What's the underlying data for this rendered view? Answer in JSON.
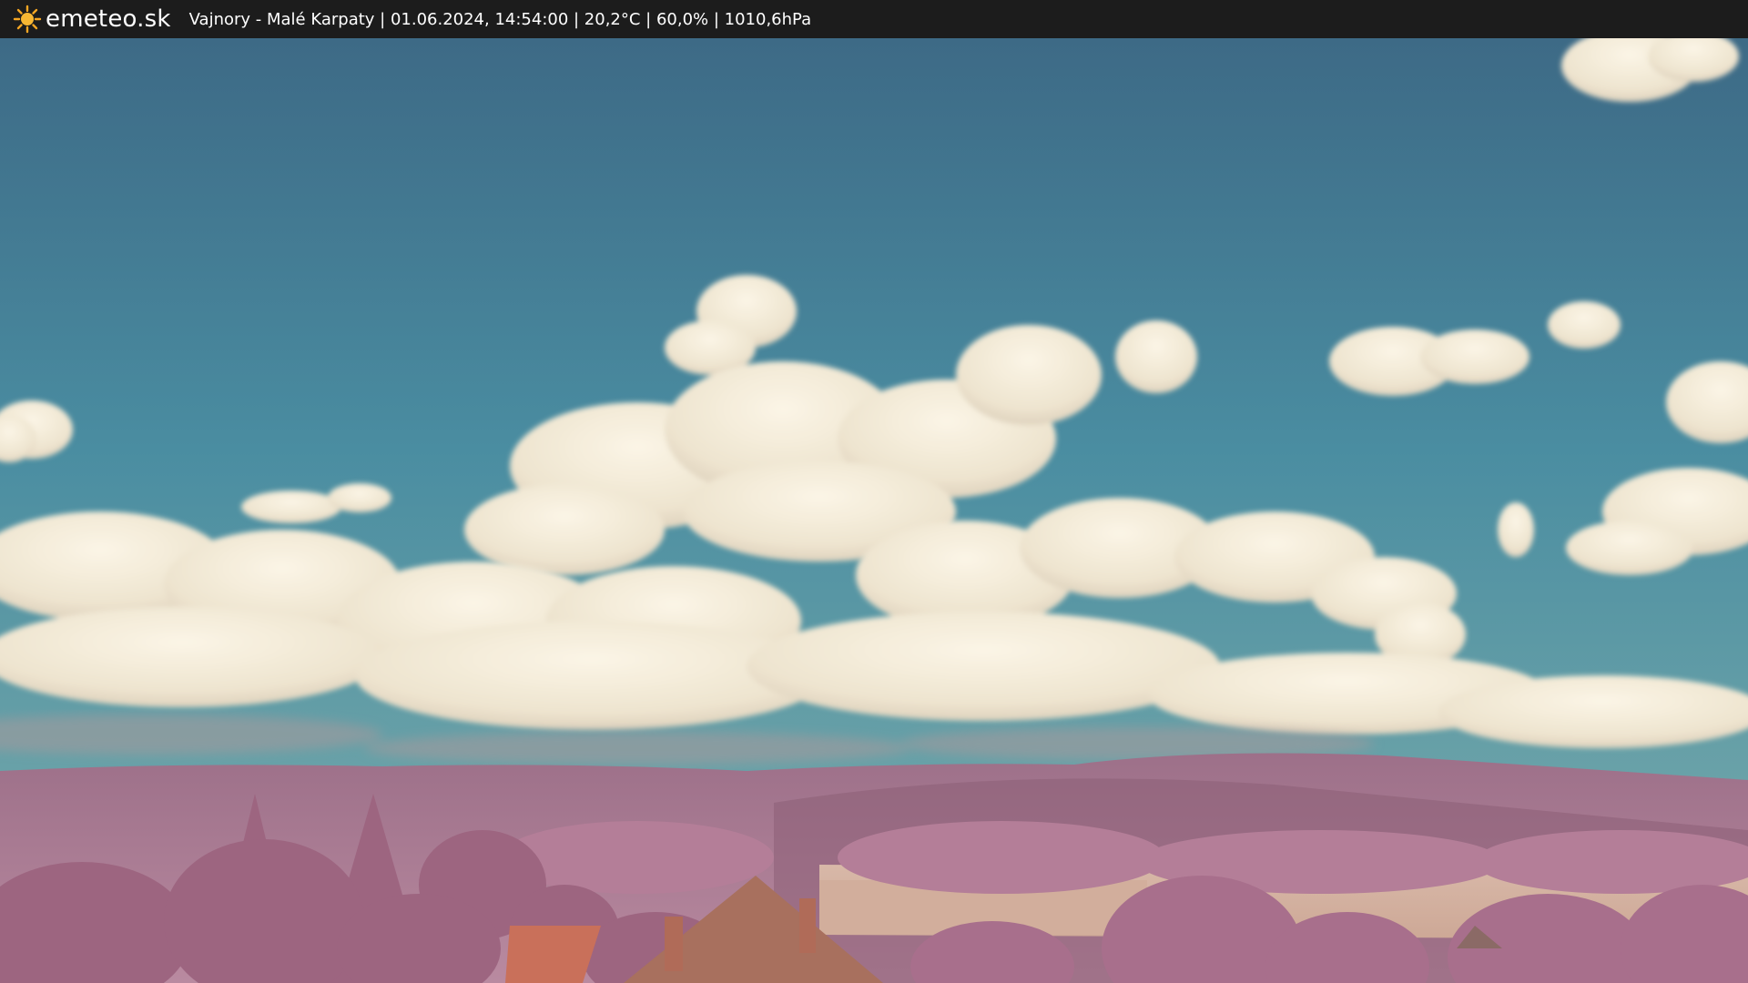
{
  "header": {
    "brand": "emeteo.sk",
    "caption": "Vajnory - Malé Karpaty | 01.06.2024, 14:54:00 | 20,2°C | 60,0% | 1010,6hPa",
    "logo_icon": "sun-icon",
    "bar_color": "#1c1c1c",
    "sun_color": "#f5a623"
  },
  "scene": {
    "sky_top": "#3d6a86",
    "sky_bottom": "#4e93a4",
    "cloud_color": "#f2ead8",
    "foliage_color": "#b77e9a",
    "roof_color": "#c0705a"
  }
}
